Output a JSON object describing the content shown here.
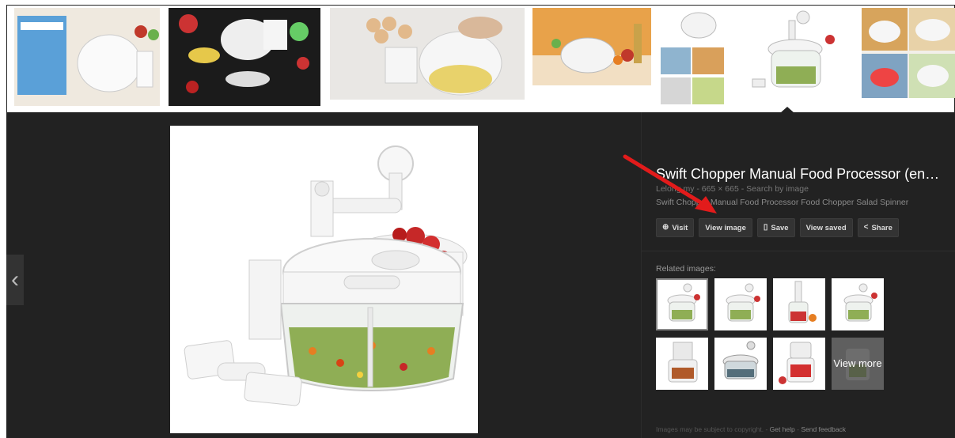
{
  "detail": {
    "title": "Swift Chopper Manual Food Processor (en…",
    "source": "Lelong.my",
    "dimensions": "665 × 665",
    "search_by_image": "Search by image",
    "description": "Swift Chopper Manual Food Processor Food Chopper Salad Spinner",
    "separator": " - "
  },
  "actions": {
    "visit": "Visit",
    "view_image": "View image",
    "save": "Save",
    "view_saved": "View saved",
    "share": "Share"
  },
  "related": {
    "label": "Related images:",
    "view_more": "View more"
  },
  "footer": {
    "notice": "Images may be subject to copyright.",
    "get_help": "Get help",
    "send_feedback": "Send feedback",
    "separator": " - "
  },
  "nav": {
    "prev_glyph": "‹"
  },
  "colors": {
    "panel_bg": "#222222",
    "annotation_arrow": "#e21b1b"
  }
}
